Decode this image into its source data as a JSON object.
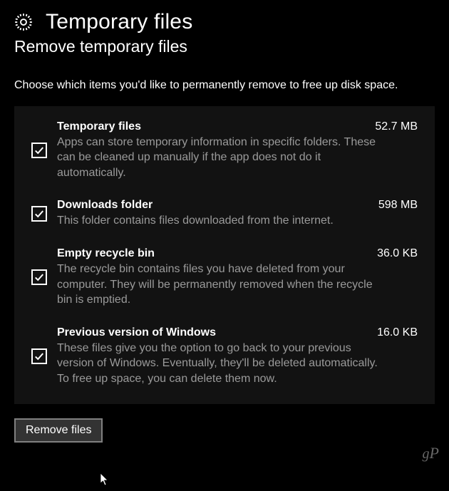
{
  "header": {
    "title": "Temporary files",
    "subtitle": "Remove temporary files",
    "description": "Choose which items you'd like to permanently remove to free up disk space."
  },
  "items": [
    {
      "title": "Temporary files",
      "size": "52.7 MB",
      "desc": "Apps can store temporary information in specific folders. These can be cleaned up manually if the app does not do it automatically.",
      "checked": true
    },
    {
      "title": "Downloads folder",
      "size": "598 MB",
      "desc": "This folder contains files downloaded from the internet.",
      "checked": true
    },
    {
      "title": "Empty recycle bin",
      "size": "36.0 KB",
      "desc": "The recycle bin contains files you have deleted from your computer. They will be permanently removed when the recycle bin is emptied.",
      "checked": true
    },
    {
      "title": "Previous version of Windows",
      "size": "16.0 KB",
      "desc": "These files give you the option to go back to your previous version of Windows. Eventually, they'll be deleted automatically. To free up space, you can delete them now.",
      "checked": true
    }
  ],
  "actions": {
    "remove_label": "Remove files"
  },
  "watermark": "gP"
}
